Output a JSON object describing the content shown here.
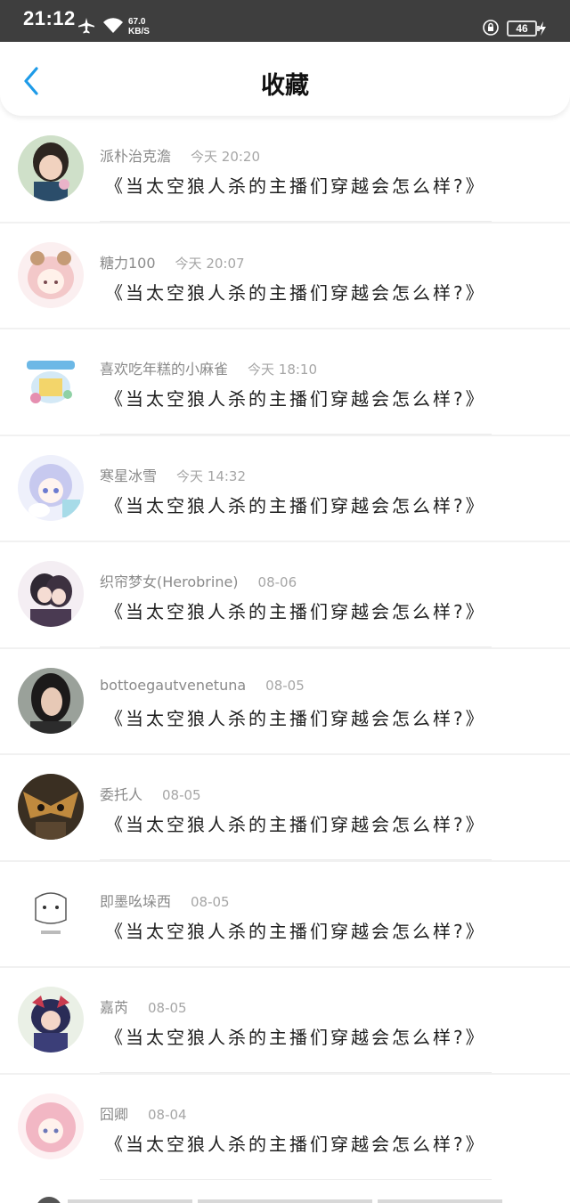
{
  "status": {
    "time": "21:12",
    "speed_value": "67.0",
    "speed_unit": "KB/S",
    "battery": "46"
  },
  "nav": {
    "title": "收藏"
  },
  "items": [
    {
      "name": "派朴治克澹",
      "time": "今天 20:20",
      "content": "《当太空狼人杀的主播们穿越会怎么样?》"
    },
    {
      "name": "糖力100",
      "time": "今天 20:07",
      "content": "《当太空狼人杀的主播们穿越会怎么样?》"
    },
    {
      "name": "喜欢吃年糕的小麻雀",
      "time": "今天 18:10",
      "content": "《当太空狼人杀的主播们穿越会怎么样?》"
    },
    {
      "name": "寒星冰雪",
      "time": "今天 14:32",
      "content": "《当太空狼人杀的主播们穿越会怎么样?》"
    },
    {
      "name": "织帘梦女(Herobrine)",
      "time": "08-06",
      "content": "《当太空狼人杀的主播们穿越会怎么样?》"
    },
    {
      "name": "bottoegautvenetuna",
      "time": "08-05",
      "content": "《当太空狼人杀的主播们穿越会怎么样?》"
    },
    {
      "name": "委托人",
      "time": "08-05",
      "content": "《当太空狼人杀的主播们穿越会怎么样?》"
    },
    {
      "name": "即墨吆垛西",
      "time": "08-05",
      "content": "《当太空狼人杀的主播们穿越会怎么样?》"
    },
    {
      "name": "嘉芮",
      "time": "08-05",
      "content": "《当太空狼人杀的主播们穿越会怎么样?》"
    },
    {
      "name": "囧卿",
      "time": "08-04",
      "content": "《当太空狼人杀的主播们穿越会怎么样?》"
    }
  ],
  "colors": {
    "status_bar": "#3e3e3e",
    "accent": "#1e9be8"
  }
}
